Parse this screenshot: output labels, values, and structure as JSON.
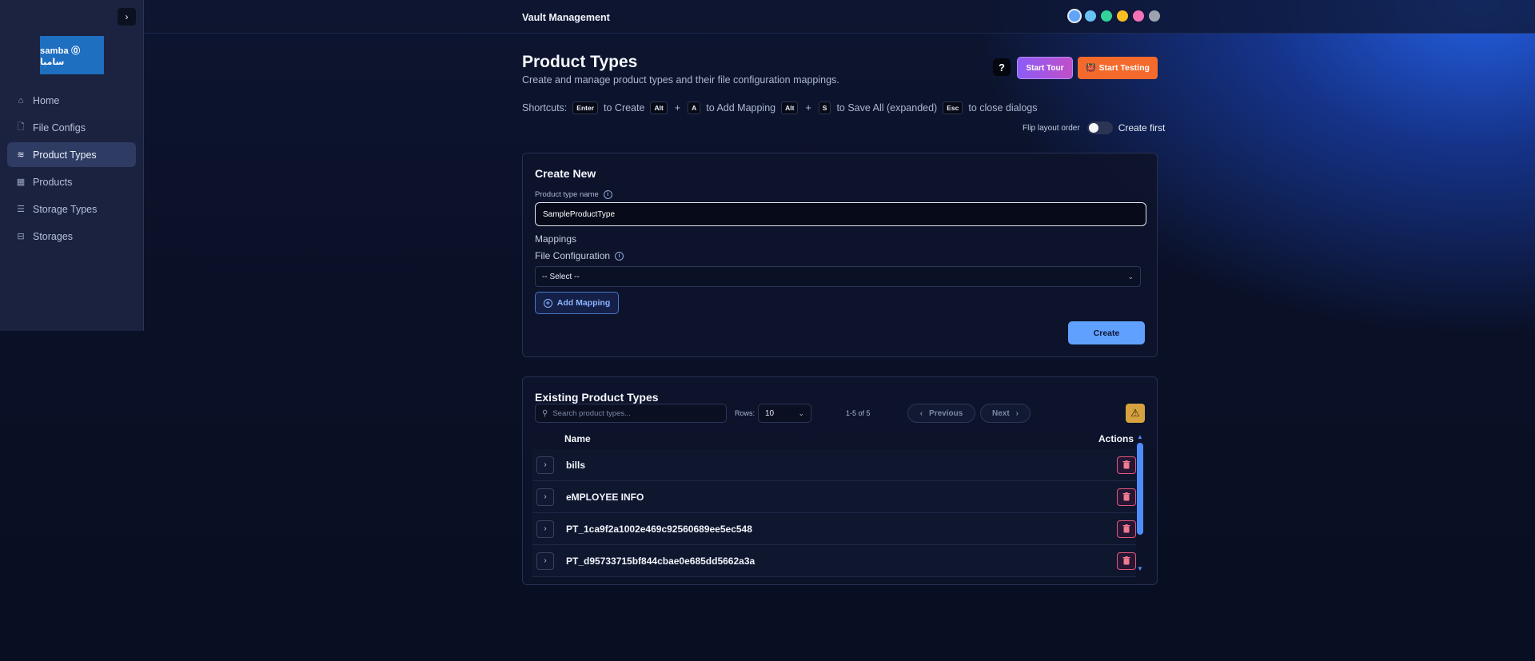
{
  "app": {
    "title": "Vault Management"
  },
  "sidebar": {
    "collapse_icon": "chevron-right-icon",
    "logo_text": "samba ⓪ سامبا",
    "items": [
      {
        "label": "Home",
        "icon": "home-icon",
        "glyph": "⌂",
        "active": false
      },
      {
        "label": "File Configs",
        "icon": "file-icon",
        "glyph": "🗋",
        "active": false
      },
      {
        "label": "Product Types",
        "icon": "layers-icon",
        "glyph": "≋",
        "active": true
      },
      {
        "label": "Products",
        "icon": "table-icon",
        "glyph": "▦",
        "active": false
      },
      {
        "label": "Storage Types",
        "icon": "database-icon",
        "glyph": "☰",
        "active": false
      },
      {
        "label": "Storages",
        "icon": "archive-icon",
        "glyph": "⊟",
        "active": false
      }
    ]
  },
  "theme_colors": [
    "#60a5fa",
    "#67c3f3",
    "#34d399",
    "#fbbf24",
    "#f472b6",
    "#9ca3af"
  ],
  "header": {
    "title": "Product Types",
    "subtitle": "Create and manage product types and their file configuration mappings.",
    "help_label": "?",
    "tour_label": "Start Tour",
    "testing_label": "Start Testing",
    "testing_icon": "👹"
  },
  "shortcuts": {
    "prefix": "Shortcuts:",
    "enter_key": "Enter",
    "enter_text": "to Create",
    "alt_key": "Alt",
    "a_key": "A",
    "a_text": "to Add Mapping",
    "alt_key2": "Alt",
    "s_key": "S",
    "s_text": "to Save All (expanded)",
    "esc_key": "Esc",
    "esc_text": "to close dialogs",
    "plus": "+"
  },
  "flip": {
    "left_label": "Flip layout order",
    "right_label": "Create first",
    "enabled": false
  },
  "create": {
    "title": "Create New",
    "name_label": "Product type name",
    "name_value": "SampleProductType",
    "mappings_label": "Mappings",
    "file_config_label": "File Configuration",
    "select_value": "-- Select --",
    "add_mapping_label": "Add Mapping",
    "create_label": "Create"
  },
  "existing": {
    "title": "Existing Product Types",
    "search_placeholder": "Search product types...",
    "rows_label": "Rows:",
    "rows_value": "10",
    "range_text": "1-5 of 5",
    "prev_label": "Previous",
    "next_label": "Next",
    "col_name": "Name",
    "col_actions": "Actions",
    "rows": [
      {
        "name": "bills"
      },
      {
        "name": "eMPLOYEE INFO"
      },
      {
        "name": "PT_1ca9f2a1002e469c92560689ee5ec548"
      },
      {
        "name": "PT_d95733715bf844cbae0e685dd5662a3a"
      }
    ]
  }
}
